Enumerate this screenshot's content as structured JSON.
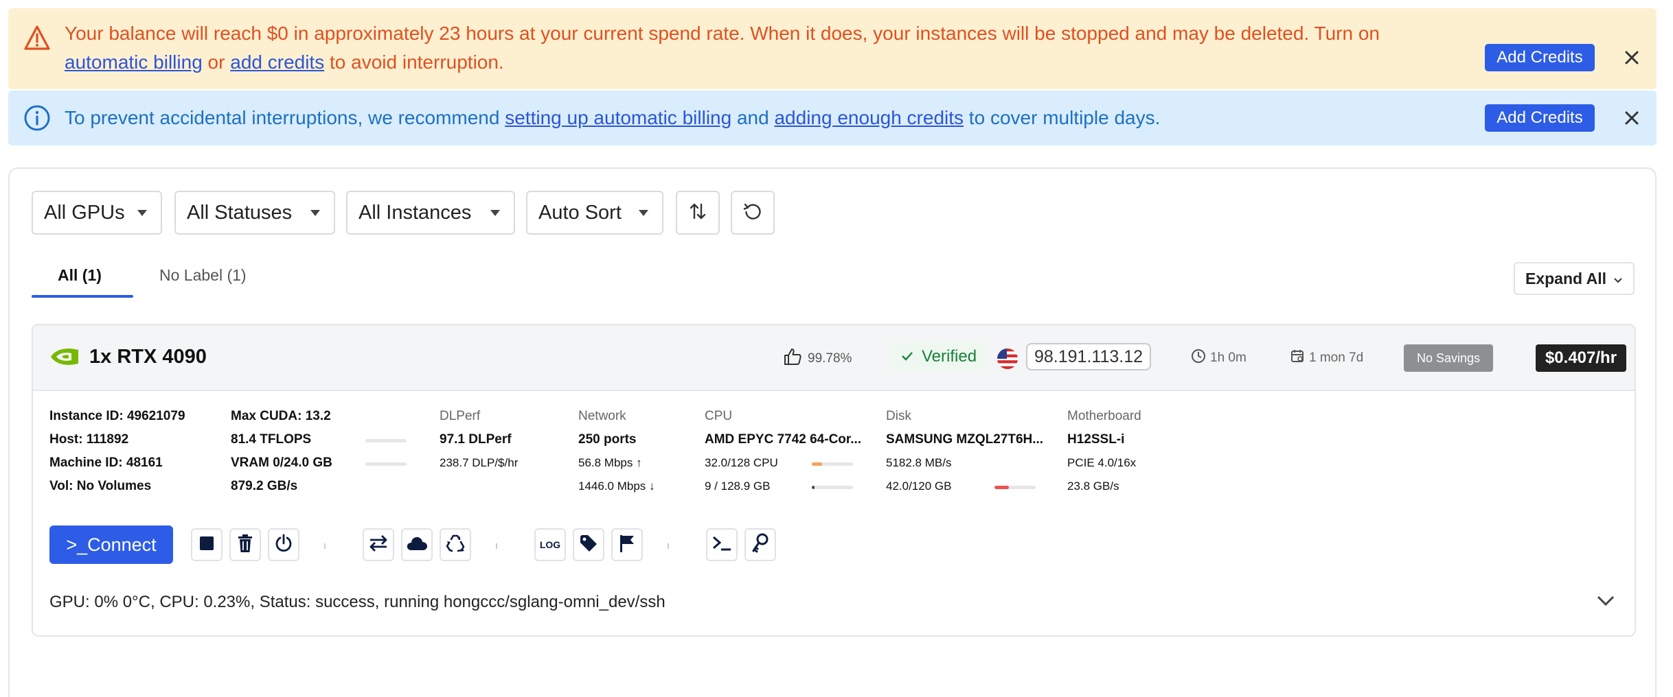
{
  "warning_banner": {
    "text_1": "Your balance will reach $0 in approximately 23 hours at your current spend rate. When it does, your instances will be stopped and may be deleted. Turn on ",
    "link_1": "automatic billing",
    "text_2": " or ",
    "link_2": "add credits",
    "text_3": " to avoid interruption.",
    "button": "Add Credits",
    "icon": "warning-triangle-icon"
  },
  "info_banner": {
    "text_1": "To prevent accidental interruptions, we recommend ",
    "link_1": "setting up automatic billing",
    "text_2": " and ",
    "link_2": "adding enough credits",
    "text_3": " to cover multiple days.",
    "button": "Add Credits",
    "icon": "info-circle-icon"
  },
  "filters": {
    "gpus": "All GPUs",
    "statuses": "All Statuses",
    "instances": "All Instances",
    "sort": "Auto Sort"
  },
  "tabs": [
    {
      "label": "All (1)",
      "active": true
    },
    {
      "label": "No Label (1)",
      "active": false
    }
  ],
  "expand_all": "Expand All",
  "instance": {
    "gpu": "1x RTX 4090",
    "reliability": "99.78%",
    "verified": "Verified",
    "ip": "98.191.113.12",
    "uptime": "1h 0m",
    "duration": "1 mon 7d",
    "savings": "No Savings",
    "price": "$0.407/hr",
    "ids": {
      "instance_id": "Instance ID: 49621079",
      "host": "Host: 111892",
      "machine_id": "Machine ID: 48161",
      "vol": "Vol: No Volumes"
    },
    "gpu_specs": {
      "max_cuda": "Max CUDA: 13.2",
      "tflops": "81.4 TFLOPS",
      "vram": "VRAM 0/24.0 GB",
      "bandwidth": "879.2 GB/s",
      "tflops_level": 0,
      "vram_level": 0
    },
    "dlperf": {
      "header": "DLPerf",
      "value": "97.1 DLPerf",
      "per_dollar": "238.7 DLP/$/hr"
    },
    "network": {
      "header": "Network",
      "ports": "250 ports",
      "upload": "56.8 Mbps",
      "download": "1446.0 Mbps"
    },
    "cpu": {
      "header": "CPU",
      "model": "AMD EPYC 7742 64-Cor...",
      "usage": "32.0/128 CPU",
      "ram": "9 / 128.9 GB",
      "usage_level": 0.25,
      "ram_level": 0.07,
      "usage_color": "#f5a25d",
      "ram_color": "#444444"
    },
    "disk": {
      "header": "Disk",
      "model": "SAMSUNG MZQL27T6H...",
      "speed": "5182.8 MB/s",
      "usage": "42.0/120 GB",
      "usage_level": 0.35,
      "usage_color": "#ef5350"
    },
    "motherboard": {
      "header": "Motherboard",
      "model": "H12SSL-i",
      "pcie": "PCIE 4.0/16x",
      "speed": "23.8 GB/s"
    },
    "connect": ">_Connect",
    "status_line": "GPU: 0% 0°C, CPU: 0.23%, Status: success, running hongccc/sglang-omni_dev/ssh",
    "actions": [
      "stop-icon",
      "delete-icon",
      "power-icon",
      "transfer-icon",
      "cloud-icon",
      "recycle-icon",
      "log-icon",
      "tag-icon",
      "flag-icon",
      "terminal-icon",
      "key-icon"
    ],
    "log_label": "LOG"
  },
  "colors": {
    "accent": "#2d5ce6",
    "warning_text": "#e0501f",
    "warning_bg": "#fdf0d1",
    "info_text": "#1f6fc2",
    "info_bg": "#d9edfd",
    "verified_green": "#198038",
    "nvidia_green": "#76b900"
  }
}
